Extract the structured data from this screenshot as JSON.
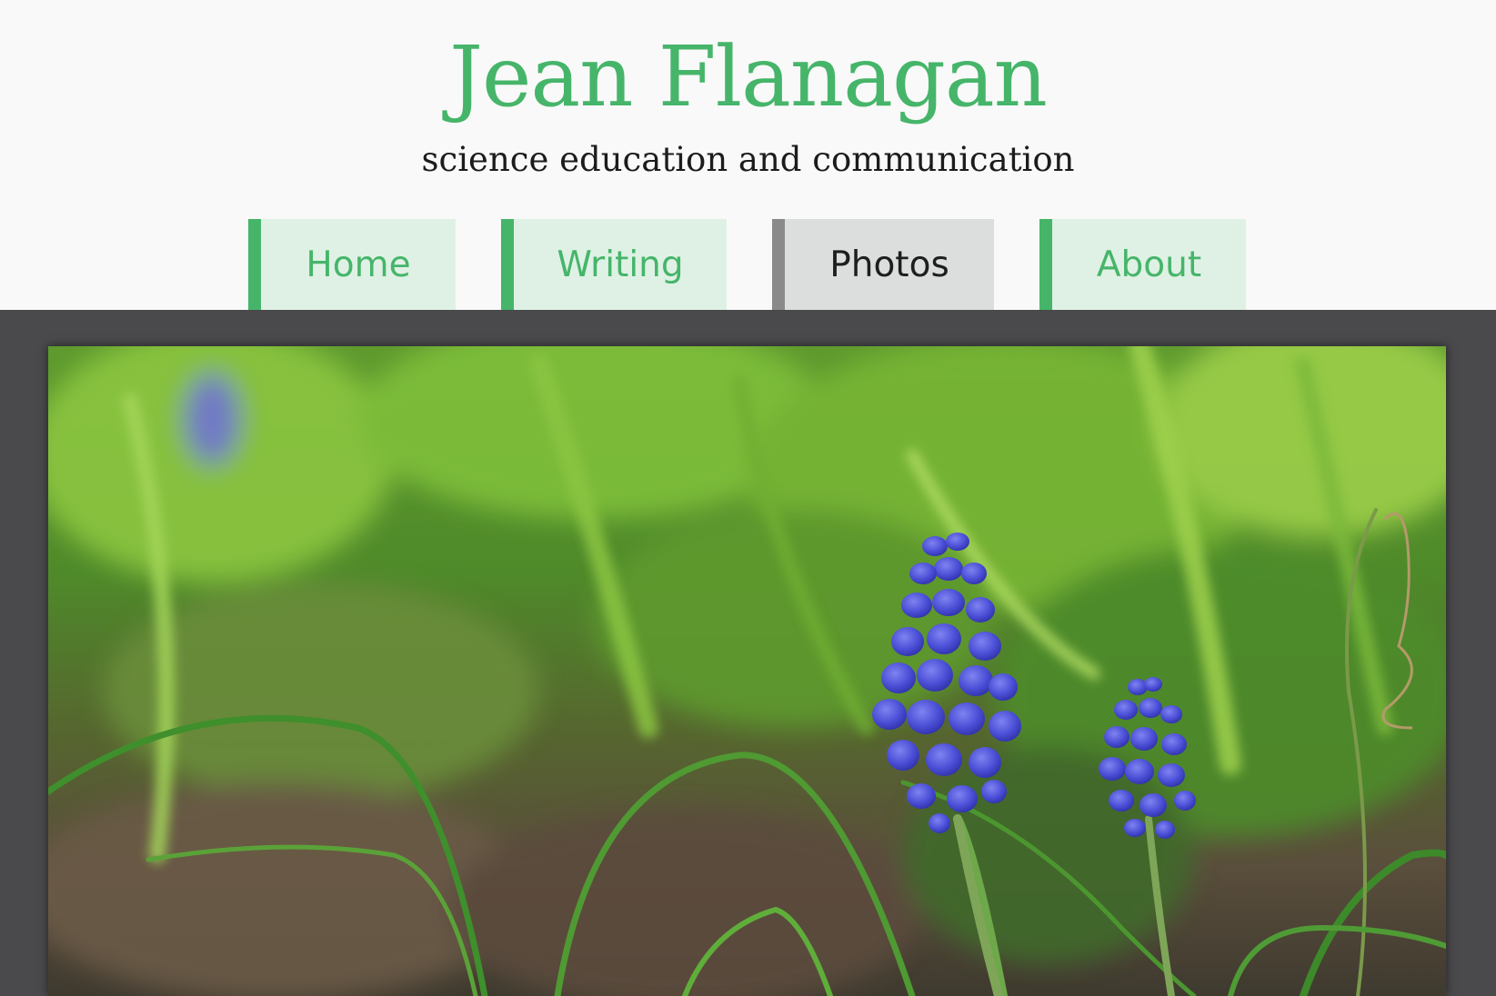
{
  "site": {
    "title": "Jean Flanagan",
    "tagline": "science education and communication"
  },
  "nav": {
    "items": [
      {
        "label": "Home",
        "active": false
      },
      {
        "label": "Writing",
        "active": false
      },
      {
        "label": "Photos",
        "active": true
      },
      {
        "label": "About",
        "active": false
      }
    ]
  },
  "colors": {
    "accent": "#46b56a",
    "nav_bg": "#dff1e5",
    "nav_active_bg": "#dcdedd",
    "nav_active_border": "#8a8a8a",
    "content_bg": "#4a4a4c",
    "header_bg": "#f9f9f9"
  },
  "photo": {
    "subject": "grape-hyacinth-flowers"
  }
}
